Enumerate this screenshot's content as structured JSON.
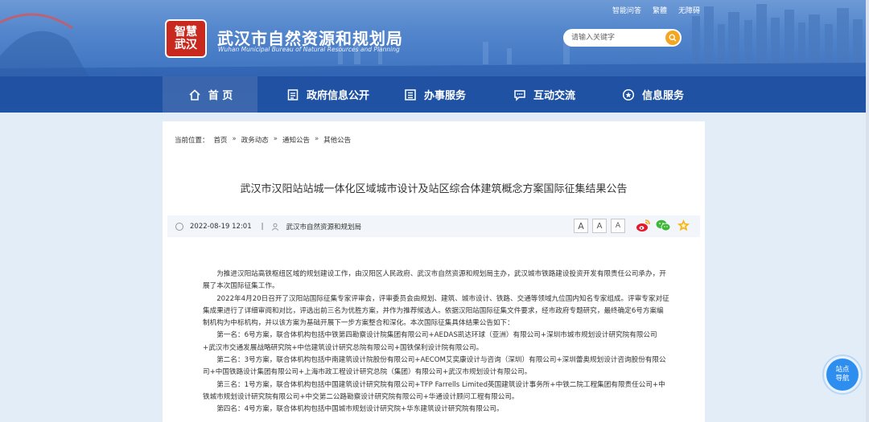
{
  "top_links": [
    "智能问答",
    "繁體",
    "无障碍"
  ],
  "logo": {
    "badge_top": "智慧",
    "badge_bottom": "武汉",
    "title": "武汉市自然资源和规划局",
    "subtitle": "Wuhan Municipal Bureau of Natural Resources and Planning"
  },
  "search": {
    "placeholder": "请输入关键字"
  },
  "nav": [
    {
      "label": "首 页",
      "icon": "home-icon"
    },
    {
      "label": "政府信息公开",
      "icon": "document-icon"
    },
    {
      "label": "办事服务",
      "icon": "form-icon"
    },
    {
      "label": "互动交流",
      "icon": "chat-icon"
    },
    {
      "label": "信息服务",
      "icon": "info-icon"
    }
  ],
  "breadcrumb": {
    "prefix": "当前位置：",
    "items": [
      "首页",
      "政务动态",
      "通知公告",
      "其他公告"
    ],
    "separator": "»"
  },
  "article": {
    "title": "武汉市汉阳站站城一体化区域城市设计及站区综合体建筑概念方案国际征集结果公告",
    "date": "2022-08-19 12:01",
    "meta_sep": "|",
    "source": "武汉市自然资源和规划局",
    "font_sizes": [
      "A",
      "A",
      "A"
    ],
    "paragraphs": [
      "为推进汉阳站高铁枢纽区域的规划建设工作，由汉阳区人民政府、武汉市自然资源和规划局主办，武汉城市铁路建设投资开发有限责任公司承办，开展了本次国际征集工作。",
      "2022年4月20日召开了汉阳站国际征集专家评审会，评审委员会由规划、建筑、城市设计、铁路、交通等领域九位国内知名专家组成。评审专家对征集成果进行了详细审阅和对比，评选出前三名为优胜方案，并作为推荐候选人。依据汉阳站国际征集文件要求，经市政府专题研究，最终确定6号方案编制机构为中标机构，并以该方案为基础开展下一步方案整合和深化。本次国际征集具体结果公告如下：",
      "第一名：6号方案，联合体机构包括中铁第四勘察设计院集团有限公司+AEDAS凯达环球（亚洲）有限公司+深圳市城市规划设计研究院有限公司+武汉市交通发展战略研究院+中信建筑设计研究总院有限公司+国铁保利设计院有限公司。",
      "第二名：3号方案，联合体机构包括中南建筑设计院股份有限公司+AECOM艾奕康设计与咨询（深圳）有限公司+深圳蕾奥规划设计咨询股份有限公司+中国铁路设计集团有限公司+上海市政工程设计研究总院（集团）有限公司+武汉市规划设计有限公司。",
      "第三名：1号方案，联合体机构包括中国建筑设计研究院有限公司+TFP Farrells Limited英国建筑设计事务所+中铁二院工程集团有限责任公司+中铁城市规划设计研究院有限公司+中交第二公路勘察设计研究院有限公司+华通设计顾问工程有限公司。",
      "第四名：4号方案，联合体机构包括中国城市规划设计研究院+华东建筑设计研究院有限公司。"
    ]
  },
  "float_guide": {
    "line1": "站点",
    "line2": "导航"
  },
  "colors": {
    "header_blue": "#2f67ba",
    "search_button": "#f4a623",
    "float_blue": "#2e8ef0",
    "badge_red": "#c8281e"
  }
}
